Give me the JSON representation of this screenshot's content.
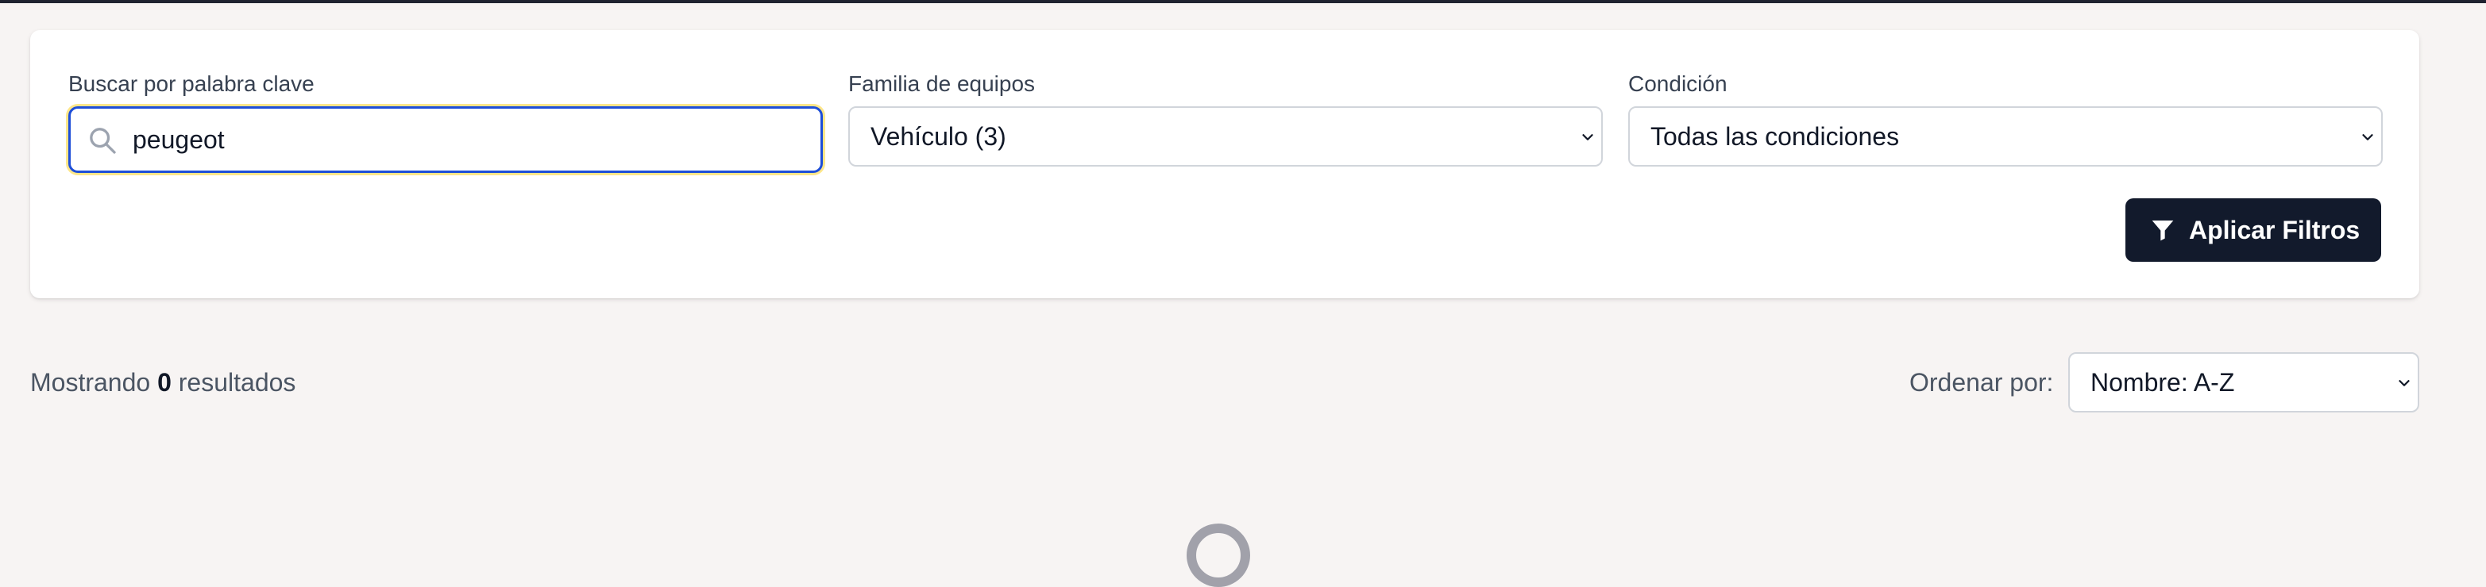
{
  "filters": {
    "keyword": {
      "label": "Buscar por palabra clave",
      "value": "peugeot",
      "icon": "search-icon"
    },
    "family": {
      "label": "Familia de equipos",
      "selected": "Vehículo (3)"
    },
    "condition": {
      "label": "Condición",
      "selected": "Todas las condiciones"
    },
    "apply_button": {
      "label": "Aplicar Filtros",
      "icon": "funnel-icon"
    }
  },
  "results": {
    "prefix": "Mostrando",
    "count": "0",
    "suffix": "resultados"
  },
  "sort": {
    "label": "Ordenar por:",
    "selected": "Nombre: A-Z"
  },
  "colors": {
    "page_background": "#f7f4f3",
    "accent": "#1d4ed8",
    "button_background": "#121a2c"
  }
}
